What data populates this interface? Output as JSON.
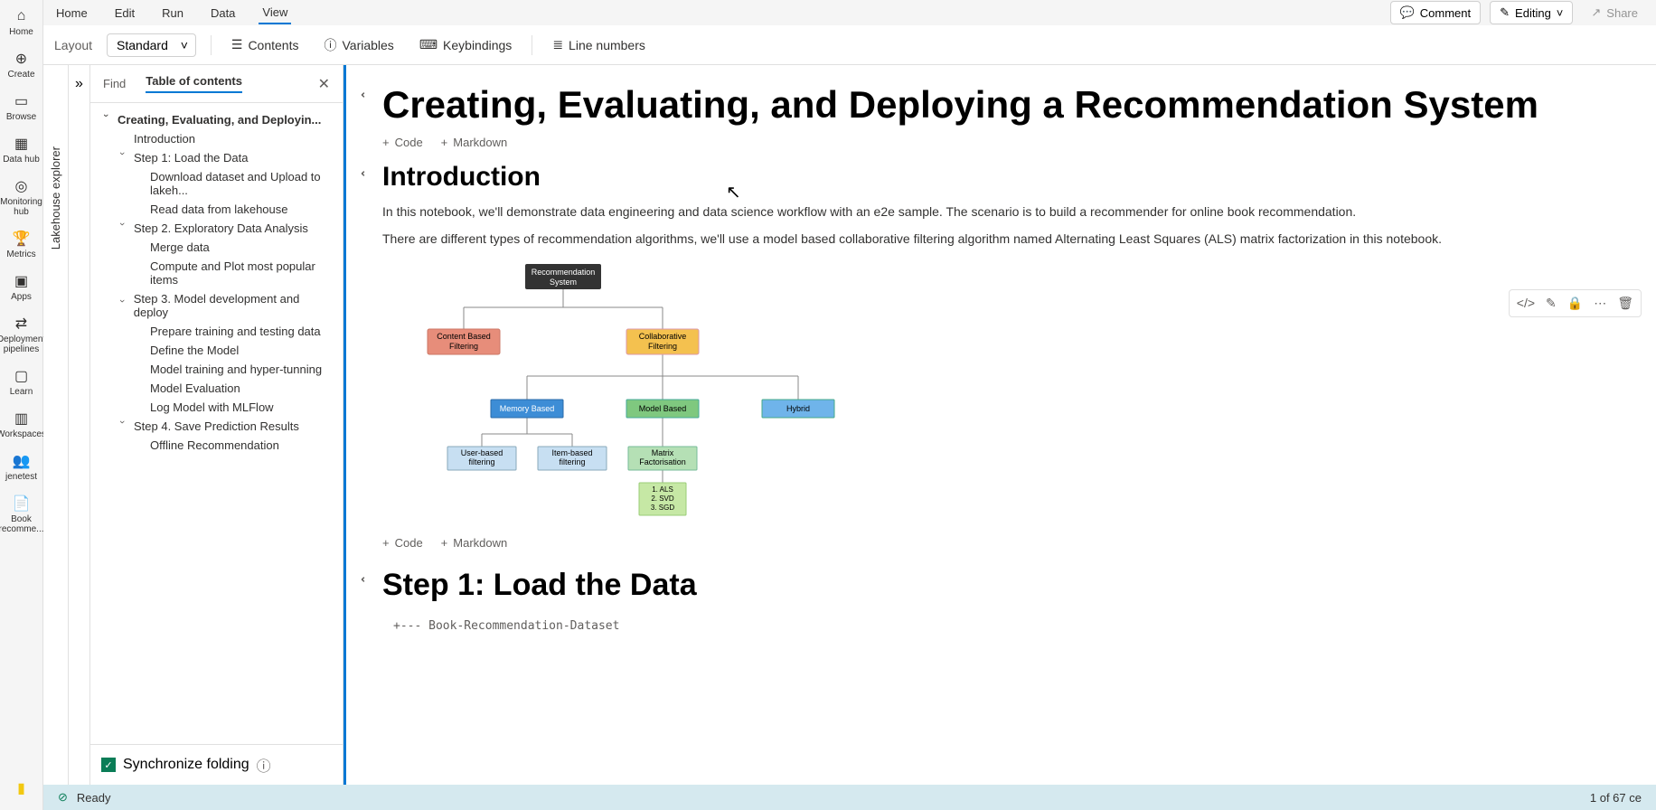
{
  "rail": [
    {
      "label": "Home",
      "icon": "⌂"
    },
    {
      "label": "Create",
      "icon": "＋"
    },
    {
      "label": "Browse",
      "icon": "▭"
    },
    {
      "label": "Data hub",
      "icon": "▦"
    },
    {
      "label": "Monitoring hub",
      "icon": "◎"
    },
    {
      "label": "Metrics",
      "icon": "🏆"
    },
    {
      "label": "Apps",
      "icon": "▣"
    },
    {
      "label": "Deployment pipelines",
      "icon": "⇄"
    },
    {
      "label": "Learn",
      "icon": "▢"
    },
    {
      "label": "Workspaces",
      "icon": "▥"
    },
    {
      "label": "jenetest",
      "icon": "👥"
    },
    {
      "label": "Book recomme...",
      "icon": "📄"
    }
  ],
  "menu": [
    "Home",
    "Edit",
    "Run",
    "Data",
    "View"
  ],
  "top_right": {
    "comment": "Comment",
    "editing": "Editing",
    "share": "Share"
  },
  "toolbar": {
    "layout_label": "Layout",
    "layout_value": "Standard",
    "contents": "Contents",
    "variables": "Variables",
    "keybindings": "Keybindings",
    "line_numbers": "Line numbers"
  },
  "lakehouse_label": "Lakehouse explorer",
  "toc": {
    "tab_find": "Find",
    "tab_toc": "Table of contents",
    "items": [
      {
        "label": "Creating, Evaluating, and Deployin...",
        "indent": 0,
        "chev": true,
        "bold": true
      },
      {
        "label": "Introduction",
        "indent": 1
      },
      {
        "label": "Step 1: Load the Data",
        "indent": 1,
        "chev": true
      },
      {
        "label": "Download dataset and Upload to lakeh...",
        "indent": 2
      },
      {
        "label": "Read data from lakehouse",
        "indent": 2
      },
      {
        "label": "Step 2. Exploratory Data Analysis",
        "indent": 1,
        "chev": true
      },
      {
        "label": "Merge data",
        "indent": 2
      },
      {
        "label": "Compute and Plot most popular items",
        "indent": 2
      },
      {
        "label": "Step 3. Model development and deploy",
        "indent": 1,
        "chev": true
      },
      {
        "label": "Prepare training and testing data",
        "indent": 2
      },
      {
        "label": "Define the Model",
        "indent": 2
      },
      {
        "label": "Model training and hyper-tunning",
        "indent": 2
      },
      {
        "label": "Model Evaluation",
        "indent": 2
      },
      {
        "label": "Log Model with MLFlow",
        "indent": 2
      },
      {
        "label": "Step 4. Save Prediction Results",
        "indent": 1,
        "chev": true
      },
      {
        "label": "Offline Recommendation",
        "indent": 2
      }
    ],
    "sync": "Synchronize folding"
  },
  "notebook": {
    "title": "Creating, Evaluating, and Deploying a Recommendation System",
    "add_code": "Code",
    "add_md": "Markdown",
    "intro_heading": "Introduction",
    "para1": "In this notebook, we'll demonstrate data engineering and data science workflow with an e2e sample. The scenario is to build a recommender for online book recommendation.",
    "para2": "There are different types of recommendation algorithms, we'll use a model based collaborative filtering algorithm named Alternating Least Squares (ALS) matrix factorization in this notebook.",
    "step1_heading": "Step 1: Load the Data",
    "code_preview": "+--- Book-Recommendation-Dataset"
  },
  "diagram": {
    "root": "Recommendation\nSystem",
    "content_based": "Content Based\nFiltering",
    "collaborative": "Collaborative\nFiltering",
    "memory": "Memory Based",
    "model": "Model Based",
    "hybrid": "Hybrid",
    "user_based": "User-based\nfiltering",
    "item_based": "Item-based\nfiltering",
    "matrix": "Matrix\nFactorisation",
    "leaf": "1. ALS\n2. SVD\n3. SGD"
  },
  "status": {
    "ready": "Ready",
    "right": "1 of 67 ce"
  }
}
